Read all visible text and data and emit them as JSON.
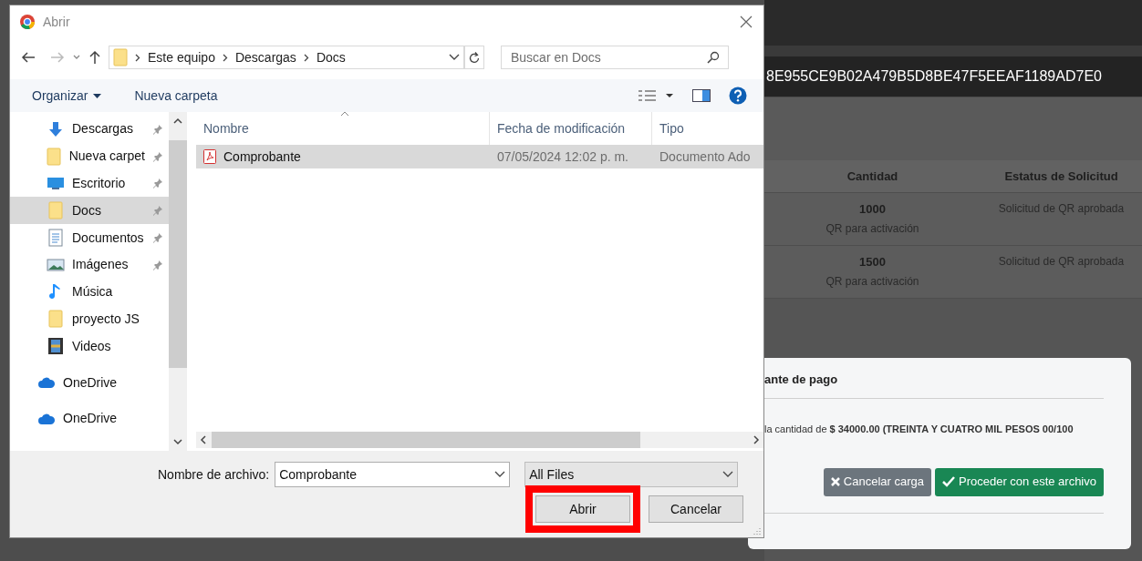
{
  "background_page": {
    "hash": "8E955CE9B02A479B5D8BE47F5EEAF1189AD7E0",
    "table": {
      "columns": [
        "Cantidad",
        "Estatus de Solicitud"
      ],
      "rows": [
        {
          "quantity": "1000",
          "note": "QR para activación",
          "status": "Solicitud de QR aprobada"
        },
        {
          "quantity": "1500",
          "note": "QR para activación",
          "status": "Solicitud de QR aprobada"
        }
      ]
    },
    "modal": {
      "title": "ante de pago",
      "message": "la cantidad de **$ 34000.00 (TREINTA Y CUATRO MIL PESOS 00/100**",
      "buttons": [
        {
          "kind": "cancel",
          "label": "Cancelar carga"
        },
        {
          "kind": "proceed",
          "label": "Proceder con este archivo"
        }
      ]
    }
  },
  "dialog": {
    "title": "Abrir",
    "breadcrumbs": [
      "Este equipo",
      "Descargas",
      "Docs"
    ],
    "search": {
      "placeholder": "Buscar en Docs"
    },
    "toolbar": [
      "Organizar",
      "Nueva carpeta"
    ],
    "nav_items": [
      {
        "label": "Descargas",
        "kind": "download",
        "pinned": true,
        "selected": false
      },
      {
        "label": "Nueva carpet",
        "kind": "folder",
        "pinned": true,
        "selected": false
      },
      {
        "label": "Escritorio",
        "kind": "desktop",
        "pinned": true,
        "selected": false
      },
      {
        "label": "Docs",
        "kind": "folder",
        "pinned": true,
        "selected": true
      },
      {
        "label": "Documentos",
        "kind": "documents",
        "pinned": true,
        "selected": false
      },
      {
        "label": "Imágenes",
        "kind": "pictures",
        "pinned": true,
        "selected": false
      },
      {
        "label": "Música",
        "kind": "music",
        "pinned": false,
        "selected": false
      },
      {
        "label": "proyecto JS",
        "kind": "folder",
        "pinned": false,
        "selected": false
      },
      {
        "label": "Videos",
        "kind": "videos",
        "pinned": false,
        "selected": false
      },
      {
        "label": "OneDrive",
        "kind": "cloud",
        "pinned": false,
        "selected": false
      },
      {
        "label": "OneDrive",
        "kind": "cloud",
        "pinned": false,
        "selected": false
      }
    ],
    "columns": [
      "Nombre",
      "Fecha de modificación",
      "Tipo"
    ],
    "files": [
      {
        "name": "Comprobante",
        "modified": "07/05/2024 12:02 p. m.",
        "type": "Documento Ado",
        "selected": true
      }
    ],
    "file_name_label": "Nombre de archivo:",
    "file_name": "Comprobante",
    "file_type": "All Files",
    "buttons": [
      {
        "label": "Abrir",
        "highlighted": true
      },
      {
        "label": "Cancelar",
        "highlighted": false
      }
    ]
  }
}
